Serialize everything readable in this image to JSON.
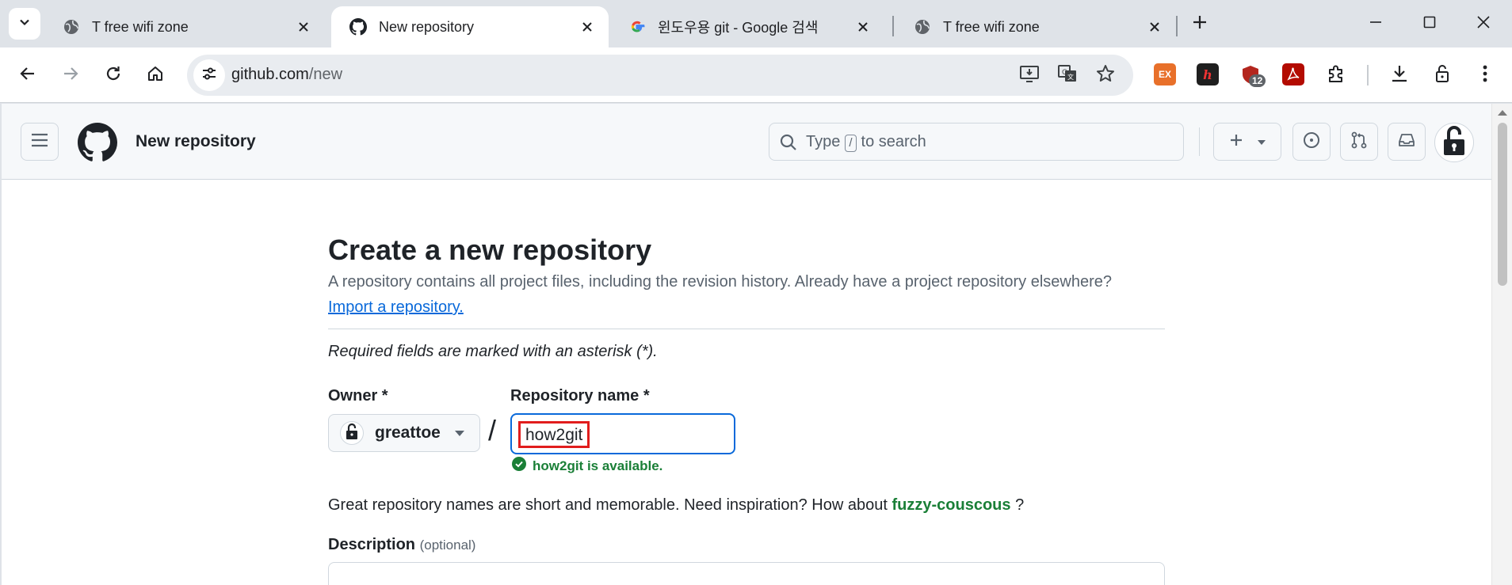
{
  "browser": {
    "tabs": [
      {
        "title": "T free wifi zone",
        "active": false,
        "favicon": "globe-icon"
      },
      {
        "title": "New repository",
        "active": true,
        "favicon": "github-icon"
      },
      {
        "title": "윈도우용 git - Google 검색",
        "active": false,
        "favicon": "google-icon"
      },
      {
        "title": "T free wifi zone",
        "active": false,
        "favicon": "globe-icon"
      }
    ],
    "url_host": "github.com",
    "url_path": "/new",
    "extensions": [
      {
        "name": "ex-extension",
        "label": "EX",
        "color": "#e8702a"
      },
      {
        "name": "h-extension",
        "label": "h",
        "color": "#1f1f1f"
      },
      {
        "name": "shield-extension",
        "label": "",
        "color": "#b3261e",
        "badge": "12"
      },
      {
        "name": "pdf-extension",
        "label": "",
        "color": "#b30b00"
      }
    ]
  },
  "header": {
    "context": "New repository",
    "search": {
      "prefix": "Type",
      "key": "/",
      "suffix": "to search"
    }
  },
  "form": {
    "title": "Create a new repository",
    "lede": "A repository contains all project files, including the revision history. Already have a project repository elsewhere?",
    "import_link": "Import a repository.",
    "required_note": "Required fields are marked with an asterisk (*).",
    "owner_label": "Owner *",
    "owner_value": "greattoe",
    "slash": "/",
    "repo_label": "Repository name *",
    "repo_value": "how2git",
    "availability": "how2git is available.",
    "inspire_text": "Great repository names are short and memorable. Need inspiration? How about",
    "inspire_suggestion": "fuzzy-couscous",
    "inspire_end": "?",
    "description_label": "Description",
    "description_optional": "(optional)"
  },
  "colors": {
    "accent_blue": "#0969da",
    "success_green": "#1a7f37",
    "highlight_red": "#e11d1d"
  }
}
